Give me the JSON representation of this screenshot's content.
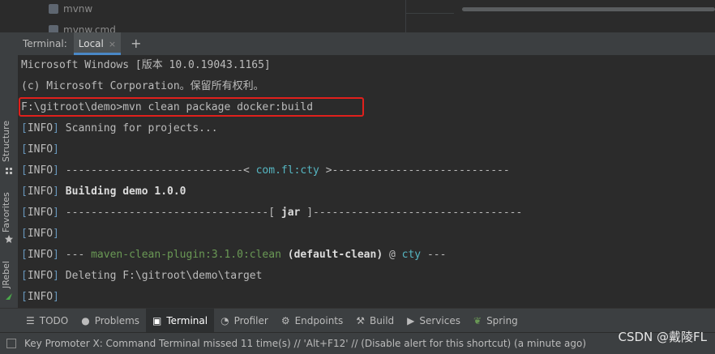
{
  "tree": {
    "items": [
      {
        "label": "mvnw",
        "icon": "folder-file-icon"
      },
      {
        "label": "mvnw.cmd",
        "icon": "file-icon"
      }
    ]
  },
  "sidebar": {
    "items": [
      {
        "label": "Structure"
      },
      {
        "label": "Favorites"
      },
      {
        "label": "JRebel"
      }
    ]
  },
  "terminal": {
    "title": "Terminal:",
    "tab_label": "Local",
    "tab_close": "×",
    "add_tab": "+",
    "lines": {
      "l1": "Microsoft Windows [版本 10.0.19043.1165]",
      "l2": "(c) Microsoft Corporation。保留所有权利。",
      "l3": "F:\\gitroot\\demo>mvn clean package docker:build",
      "info_l": "[",
      "info_w": "INFO",
      "info_r": "]",
      "l4": " Scanning for projects...",
      "l6a": " ----------------------------< ",
      "l6b": "com.fl:cty",
      "l6c": " >----------------------------",
      "l7": " Building demo 1.0.0",
      "l8a": " --------------------------------[ ",
      "l8b": "jar",
      "l8c": " ]---------------------------------",
      "l10a": " --- ",
      "l10b": "maven-clean-plugin:3.1.0:clean",
      "l10c": " (default-clean)",
      "l10d": " @ ",
      "l10e": "cty",
      "l10f": " ---",
      "l11": " Deleting F:\\gitroot\\demo\\target"
    }
  },
  "toolbar": {
    "items": [
      {
        "label": "TODO",
        "icon": "list-icon"
      },
      {
        "label": "Problems",
        "icon": "warning-icon"
      },
      {
        "label": "Terminal",
        "icon": "terminal-icon",
        "active": true
      },
      {
        "label": "Profiler",
        "icon": "profiler-icon"
      },
      {
        "label": "Endpoints",
        "icon": "endpoints-icon"
      },
      {
        "label": "Build",
        "icon": "hammer-icon"
      },
      {
        "label": "Services",
        "icon": "play-icon"
      },
      {
        "label": "Spring",
        "icon": "spring-leaf-icon"
      }
    ]
  },
  "status": {
    "message": "Key Promoter X: Command Terminal missed 11 time(s) // 'Alt+F12' // (Disable alert for this shortcut) (a minute ago)"
  },
  "watermark": "CSDN @戴陵FL",
  "colors": {
    "info": "#6897bb",
    "highlight_border": "#e0201c",
    "accent": "#4a88c7"
  }
}
